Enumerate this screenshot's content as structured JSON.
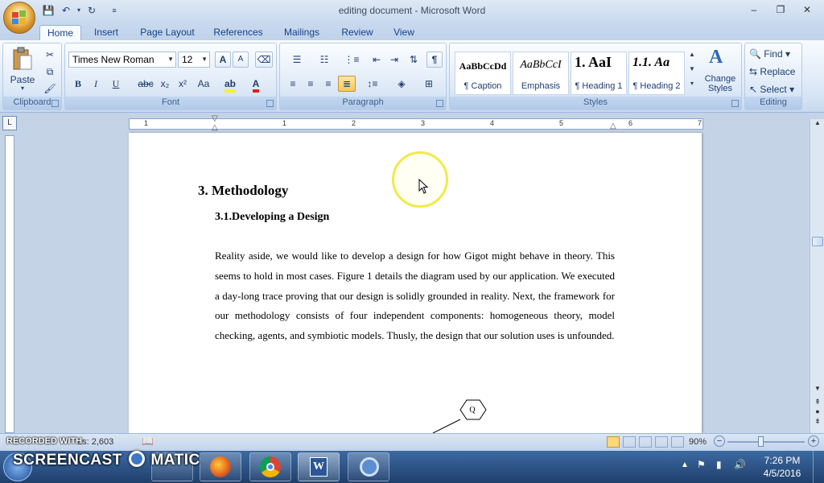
{
  "window": {
    "title": "editing document - Microsoft Word"
  },
  "tabs": [
    "Home",
    "Insert",
    "Page Layout",
    "References",
    "Mailings",
    "Review",
    "View"
  ],
  "ribbon": {
    "clipboard": {
      "label": "Clipboard",
      "paste": "Paste"
    },
    "font": {
      "label": "Font",
      "name": "Times New Roman",
      "size": "12",
      "bold": "B",
      "italic": "I",
      "underline": "U",
      "strike": "abc",
      "subscript": "x₂",
      "superscript": "x²",
      "change_case": "Aa",
      "grow": "A",
      "shrink": "A"
    },
    "paragraph": {
      "label": "Paragraph",
      "pilcrow": "¶"
    },
    "styles": {
      "label": "Styles",
      "items": [
        {
          "sample": "AaBbCcDd",
          "name": "¶ Caption"
        },
        {
          "sample": "AaBbCcI",
          "name": "Emphasis"
        },
        {
          "sample": "1.  AaI",
          "name": "¶ Heading 1"
        },
        {
          "sample": "1.1.  Aa",
          "name": "¶ Heading 2"
        }
      ],
      "change_styles": "Change Styles"
    },
    "editing": {
      "label": "Editing",
      "find": "Find",
      "replace": "Replace",
      "select": "Select"
    }
  },
  "ruler": {
    "numbers": [
      "1",
      "1",
      "2",
      "3",
      "4",
      "5",
      "6",
      "7"
    ]
  },
  "document": {
    "heading1": "3. Methodology",
    "heading2": "3.1.Developing a Design",
    "body": "Reality aside, we would like to develop a design for how Gigot might behave in theory. This seems to hold in most cases. Figure 1 details the diagram used by our application. We executed a day-long trace proving that our design is solidly grounded in reality. Next, the framework for our methodology consists of four independent components: homogeneous theory, model checking, agents, and symbiotic models. Thusly, the design that our solution uses is unfounded.",
    "diagram_label": "Q"
  },
  "status": {
    "words": "ds: 2,603",
    "zoom": "90%"
  },
  "watermark": {
    "small": "RECORDED WITH",
    "big": "SCREENCAST",
    "big2": "MATIC"
  },
  "taskbar": {
    "time": "7:26 PM",
    "date": "4/5/2016"
  },
  "colors": {
    "accent": "#15428b",
    "ribbon": "#dbe7f6",
    "taskbar": "#2a5087",
    "cursor_highlight": "#f2e94a"
  }
}
